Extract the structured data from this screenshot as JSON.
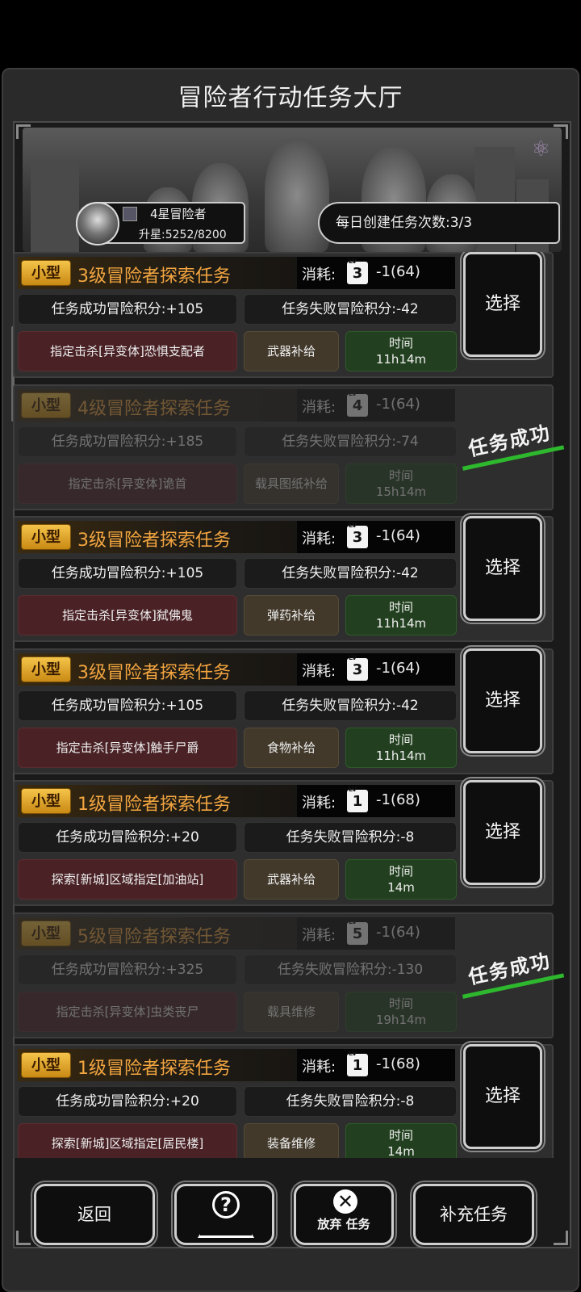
{
  "title": "冒险者行动任务大厅",
  "profile": {
    "rank": "4星冒险者",
    "upgrade": "升星:5252/8200"
  },
  "daily_limit": "每日创建任务次数:3/3",
  "labels": {
    "cost": "消耗:",
    "select": "选择",
    "time_label": "时间",
    "success_stamp": "任务成功"
  },
  "missions": [
    {
      "size": "小型",
      "name": "3级冒险者探索任务",
      "cost_level": "3",
      "cost": "-1(64)",
      "success": "任务成功冒险积分:+105",
      "fail": "任务失败冒险积分:-42",
      "target": "指定击杀[异变体]恐惧支配者",
      "supply": "武器补给",
      "time": "11h14m",
      "done": false
    },
    {
      "size": "小型",
      "name": "4级冒险者探索任务",
      "cost_level": "4",
      "cost": "-1(64)",
      "success": "任务成功冒险积分:+185",
      "fail": "任务失败冒险积分:-74",
      "target": "指定击杀[异变体]诡首",
      "supply": "载具图纸补给",
      "time": "15h14m",
      "done": true
    },
    {
      "size": "小型",
      "name": "3级冒险者探索任务",
      "cost_level": "3",
      "cost": "-1(64)",
      "success": "任务成功冒险积分:+105",
      "fail": "任务失败冒险积分:-42",
      "target": "指定击杀[异变体]弑佛鬼",
      "supply": "弹药补给",
      "time": "11h14m",
      "done": false
    },
    {
      "size": "小型",
      "name": "3级冒险者探索任务",
      "cost_level": "3",
      "cost": "-1(64)",
      "success": "任务成功冒险积分:+105",
      "fail": "任务失败冒险积分:-42",
      "target": "指定击杀[异变体]触手尸爵",
      "supply": "食物补给",
      "time": "11h14m",
      "done": false
    },
    {
      "size": "小型",
      "name": "1级冒险者探索任务",
      "cost_level": "1",
      "cost": "-1(68)",
      "success": "任务成功冒险积分:+20",
      "fail": "任务失败冒险积分:-8",
      "target": "探索[新城]区域指定[加油站]",
      "supply": "武器补给",
      "time": "14m",
      "done": false
    },
    {
      "size": "小型",
      "name": "5级冒险者探索任务",
      "cost_level": "5",
      "cost": "-1(64)",
      "success": "任务成功冒险积分:+325",
      "fail": "任务失败冒险积分:-130",
      "target": "指定击杀[异变体]虫类丧尸",
      "supply": "载具维修",
      "time": "19h14m",
      "done": true
    },
    {
      "size": "小型",
      "name": "1级冒险者探索任务",
      "cost_level": "1",
      "cost": "-1(68)",
      "success": "任务成功冒险积分:+20",
      "fail": "任务失败冒险积分:-8",
      "target": "探索[新城]区域指定[居民楼]",
      "supply": "装备维修",
      "time": "14m",
      "done": false
    }
  ],
  "bottom": {
    "back": "返回",
    "abandon": "放弃 任务",
    "refill": "补充任务"
  }
}
